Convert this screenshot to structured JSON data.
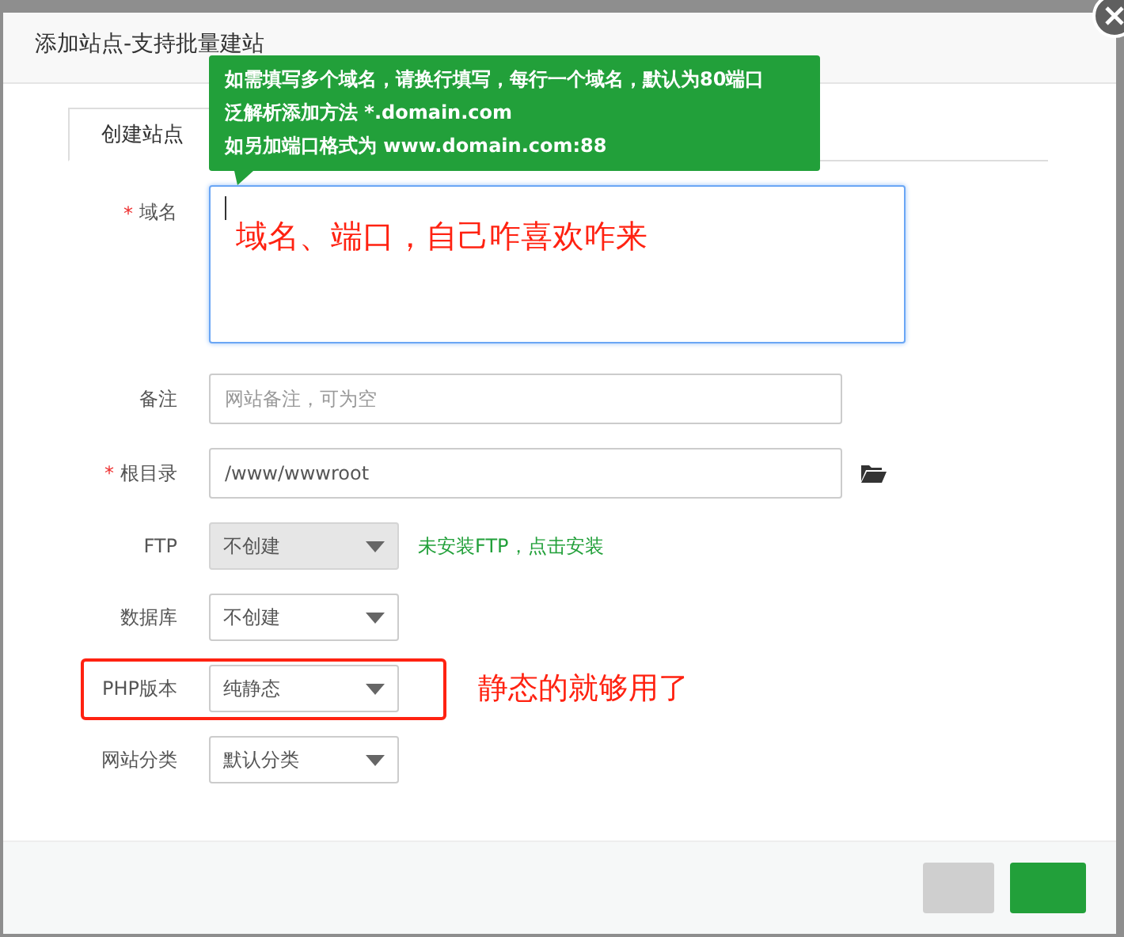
{
  "dialog": {
    "title": "添加站点-支持批量建站"
  },
  "tooltip": {
    "lines": [
      "如需填写多个域名，请换行填写，每行一个域名，默认为80端口",
      "泛解析添加方法 *.domain.com",
      "如另加端口格式为 www.domain.com:88"
    ]
  },
  "tabs": [
    {
      "label": "创建站点",
      "selected": true
    }
  ],
  "fields": [
    {
      "kind": "textarea",
      "required_mark": "*",
      "label": "域名",
      "focused": true,
      "highlighted": false,
      "note": "域名、端口，自己咋喜欢咋来"
    },
    {
      "kind": "input",
      "label": "备注",
      "placeholder": "网站备注，可为空",
      "highlighted": false
    },
    {
      "kind": "input",
      "required_mark": "*",
      "label": "根目录",
      "value": "/www/wwwroot",
      "browse": true,
      "highlighted": false
    },
    {
      "kind": "select",
      "label": "FTP",
      "value": "不创建",
      "hint": "未安装FTP，点击安装",
      "disabled": true,
      "highlighted": false
    },
    {
      "kind": "select",
      "label": "数据库",
      "value": "不创建",
      "disabled": false,
      "highlighted": false
    },
    {
      "kind": "select",
      "label": "PHP版本",
      "value": "纯静态",
      "note": "静态的就够用了",
      "disabled": false,
      "highlighted": true
    },
    {
      "kind": "select",
      "label": "网站分类",
      "value": "默认分类",
      "disabled": false,
      "highlighted": false
    }
  ],
  "buttons": [
    {
      "kind": "plain"
    },
    {
      "kind": "primary"
    }
  ]
}
